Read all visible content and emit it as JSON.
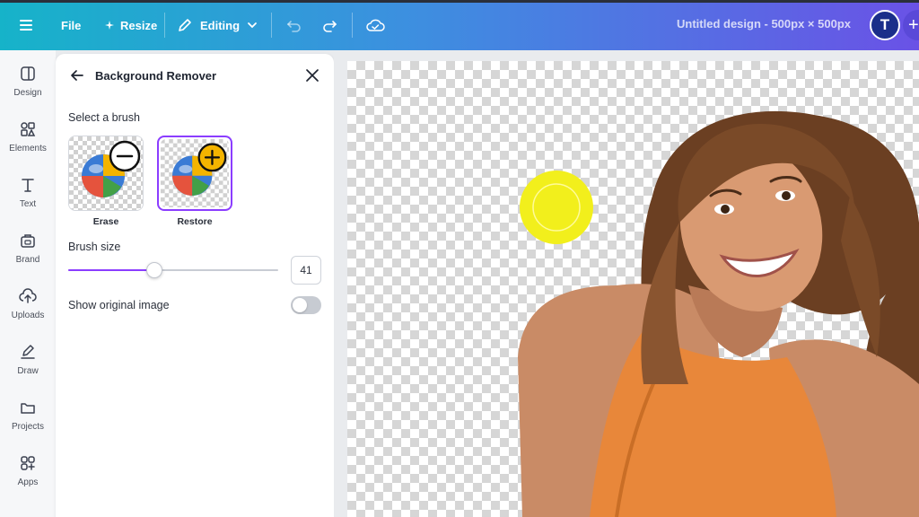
{
  "toolbar": {
    "file_label": "File",
    "resize_label": "Resize",
    "editing_label": "Editing",
    "doc_title": "Untitled design - 500px × 500px",
    "avatar_initial": "T",
    "add_label": "+"
  },
  "rail": {
    "items": [
      {
        "label": "Design",
        "icon": "design-icon"
      },
      {
        "label": "Elements",
        "icon": "elements-icon"
      },
      {
        "label": "Text",
        "icon": "text-icon"
      },
      {
        "label": "Brand",
        "icon": "brand-icon"
      },
      {
        "label": "Uploads",
        "icon": "uploads-icon"
      },
      {
        "label": "Draw",
        "icon": "draw-icon"
      },
      {
        "label": "Projects",
        "icon": "projects-icon"
      },
      {
        "label": "Apps",
        "icon": "apps-icon"
      }
    ]
  },
  "panel": {
    "title": "Background Remover",
    "select_brush_label": "Select a brush",
    "brushes": [
      {
        "label": "Erase",
        "selected": false
      },
      {
        "label": "Restore",
        "selected": true
      }
    ],
    "brush_size_label": "Brush size",
    "brush_size_value": "41",
    "brush_size_fraction": 0.41,
    "show_original_label": "Show original image",
    "show_original_on": false
  },
  "colors": {
    "accent": "#8b3dff",
    "cursor_yellow": "#f2ef1c",
    "shirt": "#e8873a"
  }
}
